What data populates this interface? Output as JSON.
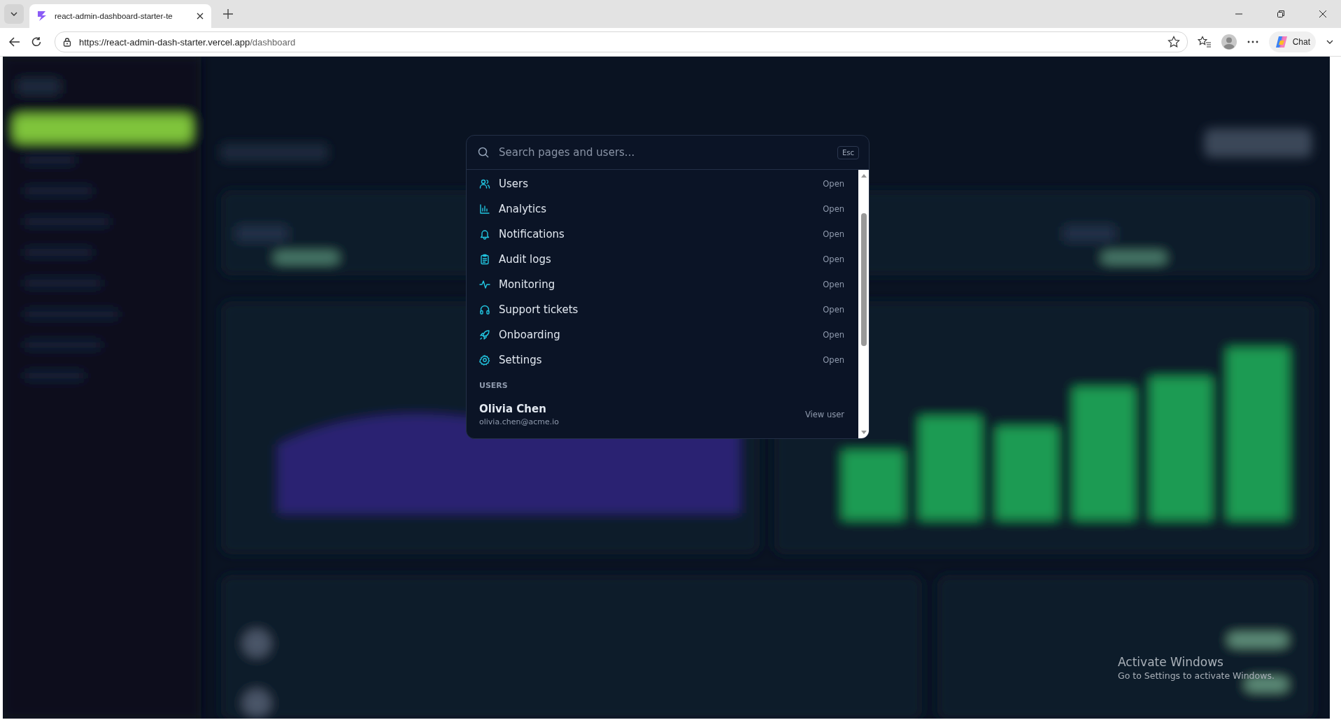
{
  "browser": {
    "tab_title": "react-admin-dashboard-starter-te",
    "url_host": "https://react-admin-dash-starter.vercel.app",
    "url_path": "/dashboard",
    "chat_label": "Chat"
  },
  "command_palette": {
    "placeholder": "Search pages and users...",
    "esc_key": "Esc",
    "pages": [
      {
        "label": "Users",
        "action": "Open",
        "kind": "users"
      },
      {
        "label": "Analytics",
        "action": "Open",
        "kind": "chart"
      },
      {
        "label": "Notifications",
        "action": "Open",
        "kind": "bell"
      },
      {
        "label": "Audit logs",
        "action": "Open",
        "kind": "clipboard"
      },
      {
        "label": "Monitoring",
        "action": "Open",
        "kind": "pulse"
      },
      {
        "label": "Support tickets",
        "action": "Open",
        "kind": "headphones"
      },
      {
        "label": "Onboarding",
        "action": "Open",
        "kind": "rocket"
      },
      {
        "label": "Settings",
        "action": "Open",
        "kind": "gear"
      }
    ],
    "users_heading": "USERS",
    "users": [
      {
        "name": "Olivia Chen",
        "email": "olivia.chen@acme.io",
        "action": "View user"
      }
    ]
  },
  "activation_notice": {
    "title": "Activate Windows",
    "message": "Go to Settings to activate Windows."
  }
}
